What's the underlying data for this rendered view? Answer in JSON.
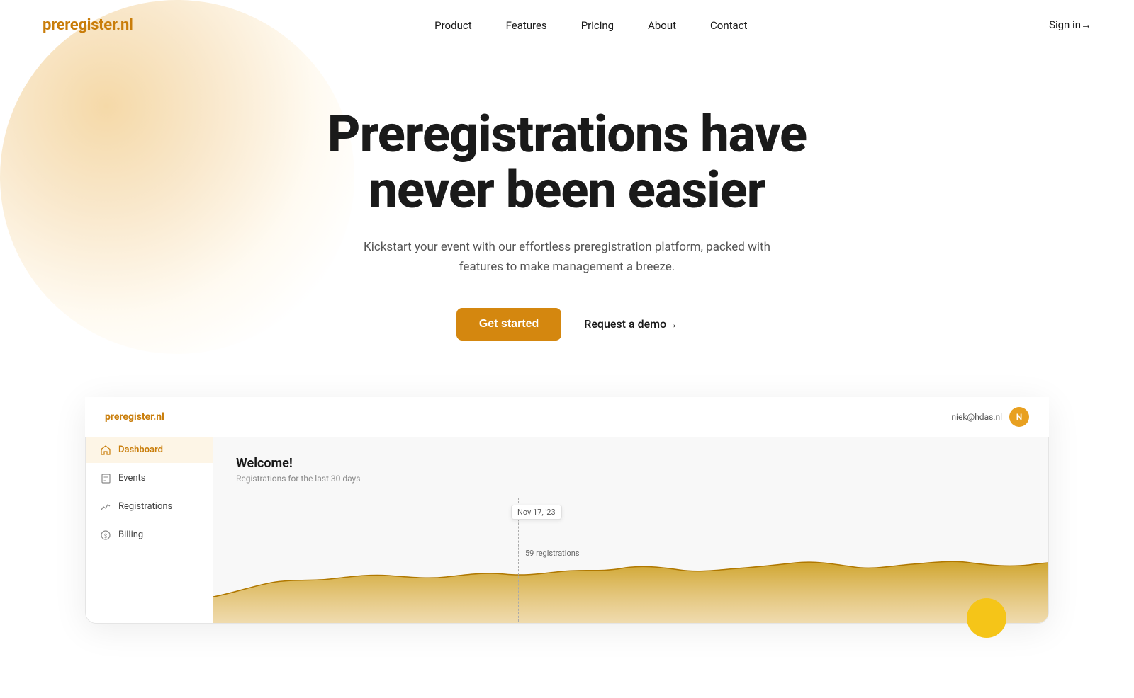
{
  "brand": {
    "logo": "preregister.nl",
    "color": "#c97d0a"
  },
  "nav": {
    "links": [
      {
        "label": "Product",
        "href": "#"
      },
      {
        "label": "Features",
        "href": "#"
      },
      {
        "label": "Pricing",
        "href": "#"
      },
      {
        "label": "About",
        "href": "#"
      },
      {
        "label": "Contact",
        "href": "#"
      }
    ],
    "signin": "Sign in→"
  },
  "hero": {
    "headline_line1": "Preregistrations have",
    "headline_line2": "never been easier",
    "subtext": "Kickstart your event with our effortless preregistration platform, packed with features to make management a breeze.",
    "cta_primary": "Get started",
    "cta_secondary": "Request a demo→"
  },
  "app_preview": {
    "logo": "preregister.nl",
    "user_email": "niek@hdas.nl",
    "sidebar_items": [
      {
        "label": "Dashboard",
        "icon": "home-icon",
        "active": true
      },
      {
        "label": "Events",
        "icon": "file-icon",
        "active": false
      },
      {
        "label": "Registrations",
        "icon": "chart-icon",
        "active": false
      },
      {
        "label": "Billing",
        "icon": "dollar-icon",
        "active": false
      }
    ],
    "dashboard": {
      "title": "Welcome!",
      "subtitle": "Registrations for the last 30 days",
      "tooltip_date": "Nov 17, '23",
      "tooltip_registrations": "59 registrations"
    }
  }
}
